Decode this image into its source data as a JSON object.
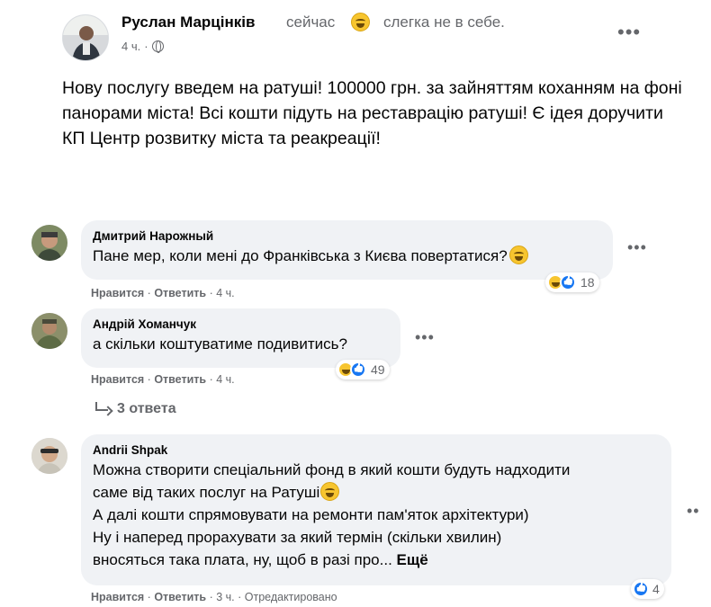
{
  "post": {
    "author": "Руслан Марцінків",
    "status": "сейчас",
    "feeling": "слегка не в себе.",
    "time": "4 ч.",
    "separator": "·",
    "text": "Нову послугу введем на ратуші! 100000 грн. за зайняттям коханням на фоні панорами міста! Всі кошти підуть на реставрацію ратуші! Є ідея доручити КП Центр розвитку міста та реакреації!"
  },
  "comments": [
    {
      "author": "Дмитрий Нарожный",
      "text": "Пане мер, коли мені до Франківська з Києва повертатися?",
      "like": "Нравится",
      "reply": "Ответить",
      "time": "4 ч.",
      "reactions_count": "18"
    },
    {
      "author": "Андрій Хоманчук",
      "text": "а скільки коштуватиме подивитись?",
      "like": "Нравится",
      "reply": "Ответить",
      "time": "4 ч.",
      "reactions_count": "49",
      "replies_label": "3 ответа"
    },
    {
      "author": "Andrii Shpak",
      "lines": [
        "Можна створити спеціальний фонд в який кошти будуть надходити",
        "саме від таких послуг на Ратуші",
        "А далі кошти спрямовувати на ремонти пам'яток архітектури)",
        "Ну і наперед прорахувати за який термін (скільки хвилин)",
        "вносяться така плата, ну, щоб в разі про..."
      ],
      "more_label": "Ещё",
      "like": "Нравится",
      "reply": "Ответить",
      "time": "3 ч.",
      "edited": "Отредактировано",
      "reactions_count": "4"
    }
  ],
  "icons": {
    "more": "more-dots-icon",
    "globe": "globe-icon",
    "emoji": "grinning-emoji-icon",
    "haha": "haha-reaction-icon",
    "like": "like-reaction-icon",
    "reply_arrow": "reply-arrow-icon"
  },
  "colors": {
    "bubble": "#f0f2f5",
    "secondary_text": "#65676b",
    "like_blue": "#1877f2",
    "haha_yellow": "#f7c52f"
  }
}
